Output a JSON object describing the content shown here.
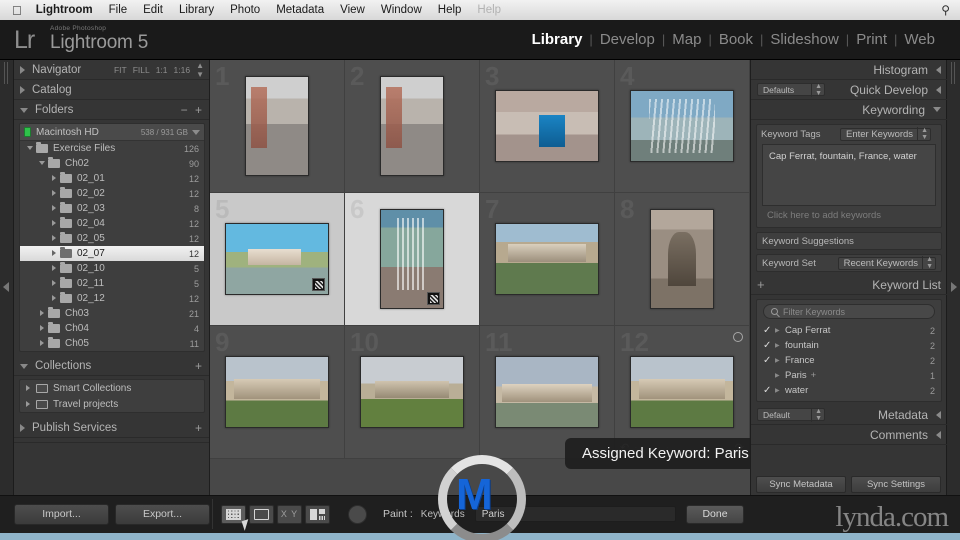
{
  "menubar": {
    "apple_icon": "apple-icon",
    "items": [
      "Lightroom",
      "File",
      "Edit",
      "Library",
      "Photo",
      "Metadata",
      "View",
      "Window",
      "Help"
    ],
    "dim_item": "Help",
    "search_icon": "search-icon"
  },
  "titlebar": {
    "logo_mark": "Lr",
    "brand_small": "Adobe Photoshop",
    "brand_name": "Lightroom 5",
    "modules": [
      "Library",
      "Develop",
      "Map",
      "Book",
      "Slideshow",
      "Print",
      "Web"
    ],
    "active_module": "Library",
    "separator": "|"
  },
  "left_panel": {
    "navigator": {
      "title": "Navigator",
      "modes": [
        "FIT",
        "FILL",
        "1:1",
        "1:16"
      ]
    },
    "catalog": {
      "title": "Catalog"
    },
    "folders": {
      "title": "Folders",
      "volume": {
        "name": "Macintosh HD",
        "size": "538 / 931 GB"
      },
      "tree": [
        {
          "label": "Exercise Files",
          "count": "126",
          "indent": 1,
          "open": true,
          "selected": false
        },
        {
          "label": "Ch02",
          "count": "90",
          "indent": 2,
          "open": true,
          "selected": false
        },
        {
          "label": "02_01",
          "count": "12",
          "indent": 3,
          "open": false,
          "selected": false
        },
        {
          "label": "02_02",
          "count": "12",
          "indent": 3,
          "open": false,
          "selected": false
        },
        {
          "label": "02_03",
          "count": "8",
          "indent": 3,
          "open": false,
          "selected": false
        },
        {
          "label": "02_04",
          "count": "12",
          "indent": 3,
          "open": false,
          "selected": false
        },
        {
          "label": "02_05",
          "count": "12",
          "indent": 3,
          "open": false,
          "selected": false
        },
        {
          "label": "02_07",
          "count": "12",
          "indent": 3,
          "open": false,
          "selected": true
        },
        {
          "label": "02_10",
          "count": "5",
          "indent": 3,
          "open": false,
          "selected": false
        },
        {
          "label": "02_11",
          "count": "5",
          "indent": 3,
          "open": false,
          "selected": false
        },
        {
          "label": "02_12",
          "count": "12",
          "indent": 3,
          "open": false,
          "selected": false
        },
        {
          "label": "Ch03",
          "count": "21",
          "indent": 2,
          "open": false,
          "selected": false
        },
        {
          "label": "Ch04",
          "count": "4",
          "indent": 2,
          "open": false,
          "selected": false
        },
        {
          "label": "Ch05",
          "count": "11",
          "indent": 2,
          "open": false,
          "selected": false
        }
      ]
    },
    "collections": {
      "title": "Collections",
      "items": [
        "Smart Collections",
        "Travel projects"
      ]
    },
    "publish_services": {
      "title": "Publish Services"
    },
    "footer": {
      "import_label": "Import...",
      "export_label": "Export..."
    }
  },
  "grid": {
    "cells": [
      {
        "index": "1",
        "photo": "ph-street",
        "orient": "portrait",
        "state": "normal",
        "badge": false
      },
      {
        "index": "2",
        "photo": "ph-street",
        "orient": "portrait",
        "state": "normal",
        "badge": false
      },
      {
        "index": "3",
        "photo": "ph-blue",
        "orient": "landscape",
        "state": "normal",
        "badge": false
      },
      {
        "index": "4",
        "photo": "ph-fount",
        "orient": "landscape",
        "state": "normal",
        "badge": false
      },
      {
        "index": "5",
        "photo": "ph-villa",
        "orient": "landscape",
        "state": "selected",
        "badge": true
      },
      {
        "index": "6",
        "photo": "ph-bigf",
        "orient": "portrait",
        "state": "active",
        "badge": true
      },
      {
        "index": "7",
        "photo": "ph-palace",
        "orient": "landscape",
        "state": "normal",
        "badge": false
      },
      {
        "index": "8",
        "photo": "ph-statue",
        "orient": "portrait",
        "state": "normal",
        "badge": false
      },
      {
        "index": "9",
        "photo": "ph-louvre",
        "orient": "landscape",
        "state": "normal",
        "badge": false
      },
      {
        "index": "10",
        "photo": "ph-louvre2",
        "orient": "landscape",
        "state": "normal",
        "badge": false
      },
      {
        "index": "11",
        "photo": "ph-louvre3",
        "orient": "landscape",
        "state": "normal",
        "badge": false
      },
      {
        "index": "12",
        "photo": "ph-louvre",
        "orient": "landscape",
        "state": "normal",
        "badge": false
      }
    ],
    "tooltip": "Assigned Keyword: Paris",
    "cursor_icon": "spray-can-cursor",
    "cell_dots": ". . . . . ."
  },
  "right_panel": {
    "histogram": {
      "title": "Histogram"
    },
    "quick_develop": {
      "title": "Quick Develop",
      "preset": "Defaults"
    },
    "keywording": {
      "title": "Keywording",
      "keyword_tags_label": "Keyword Tags",
      "keyword_tags_mode": "Enter Keywords",
      "keywords_value": "Cap Ferrat, fountain, France, water",
      "add_placeholder": "Click here to add keywords",
      "suggestions_title": "Keyword Suggestions",
      "keyword_set_label": "Keyword Set",
      "keyword_set_value": "Recent Keywords"
    },
    "keyword_list": {
      "title": "Keyword List",
      "add_icon": "plus-icon",
      "filter_placeholder": "Filter Keywords",
      "items": [
        {
          "name": "Cap Ferrat",
          "count": "2",
          "checked": true,
          "plus": false
        },
        {
          "name": "fountain",
          "count": "2",
          "checked": true,
          "plus": false
        },
        {
          "name": "France",
          "count": "2",
          "checked": true,
          "plus": false
        },
        {
          "name": "Paris",
          "count": "1",
          "checked": false,
          "plus": true
        },
        {
          "name": "water",
          "count": "2",
          "checked": true,
          "plus": false
        }
      ]
    },
    "metadata": {
      "title": "Metadata",
      "preset": "Default"
    },
    "comments": {
      "title": "Comments"
    },
    "footer": {
      "sync_metadata_label": "Sync Metadata",
      "sync_settings_label": "Sync Settings"
    }
  },
  "toolbar": {
    "view_modes": [
      "grid-view-icon",
      "loupe-view-icon",
      "compare-view-icon",
      "survey-view-icon"
    ],
    "compare_label": "X Y",
    "paint_label": "Paint :",
    "paint_kind": "Keywords",
    "paint_value": "Paris",
    "done_label": "Done"
  },
  "watermark": {
    "text": "lynda.com",
    "logo_letter": "M"
  },
  "colors": {
    "panel_bg": "#353535",
    "grid_bg": "#484848",
    "selected_cell": "#c9c9c9",
    "accent_blue": "#1565d8",
    "status_bar": "#8fb4c9"
  }
}
